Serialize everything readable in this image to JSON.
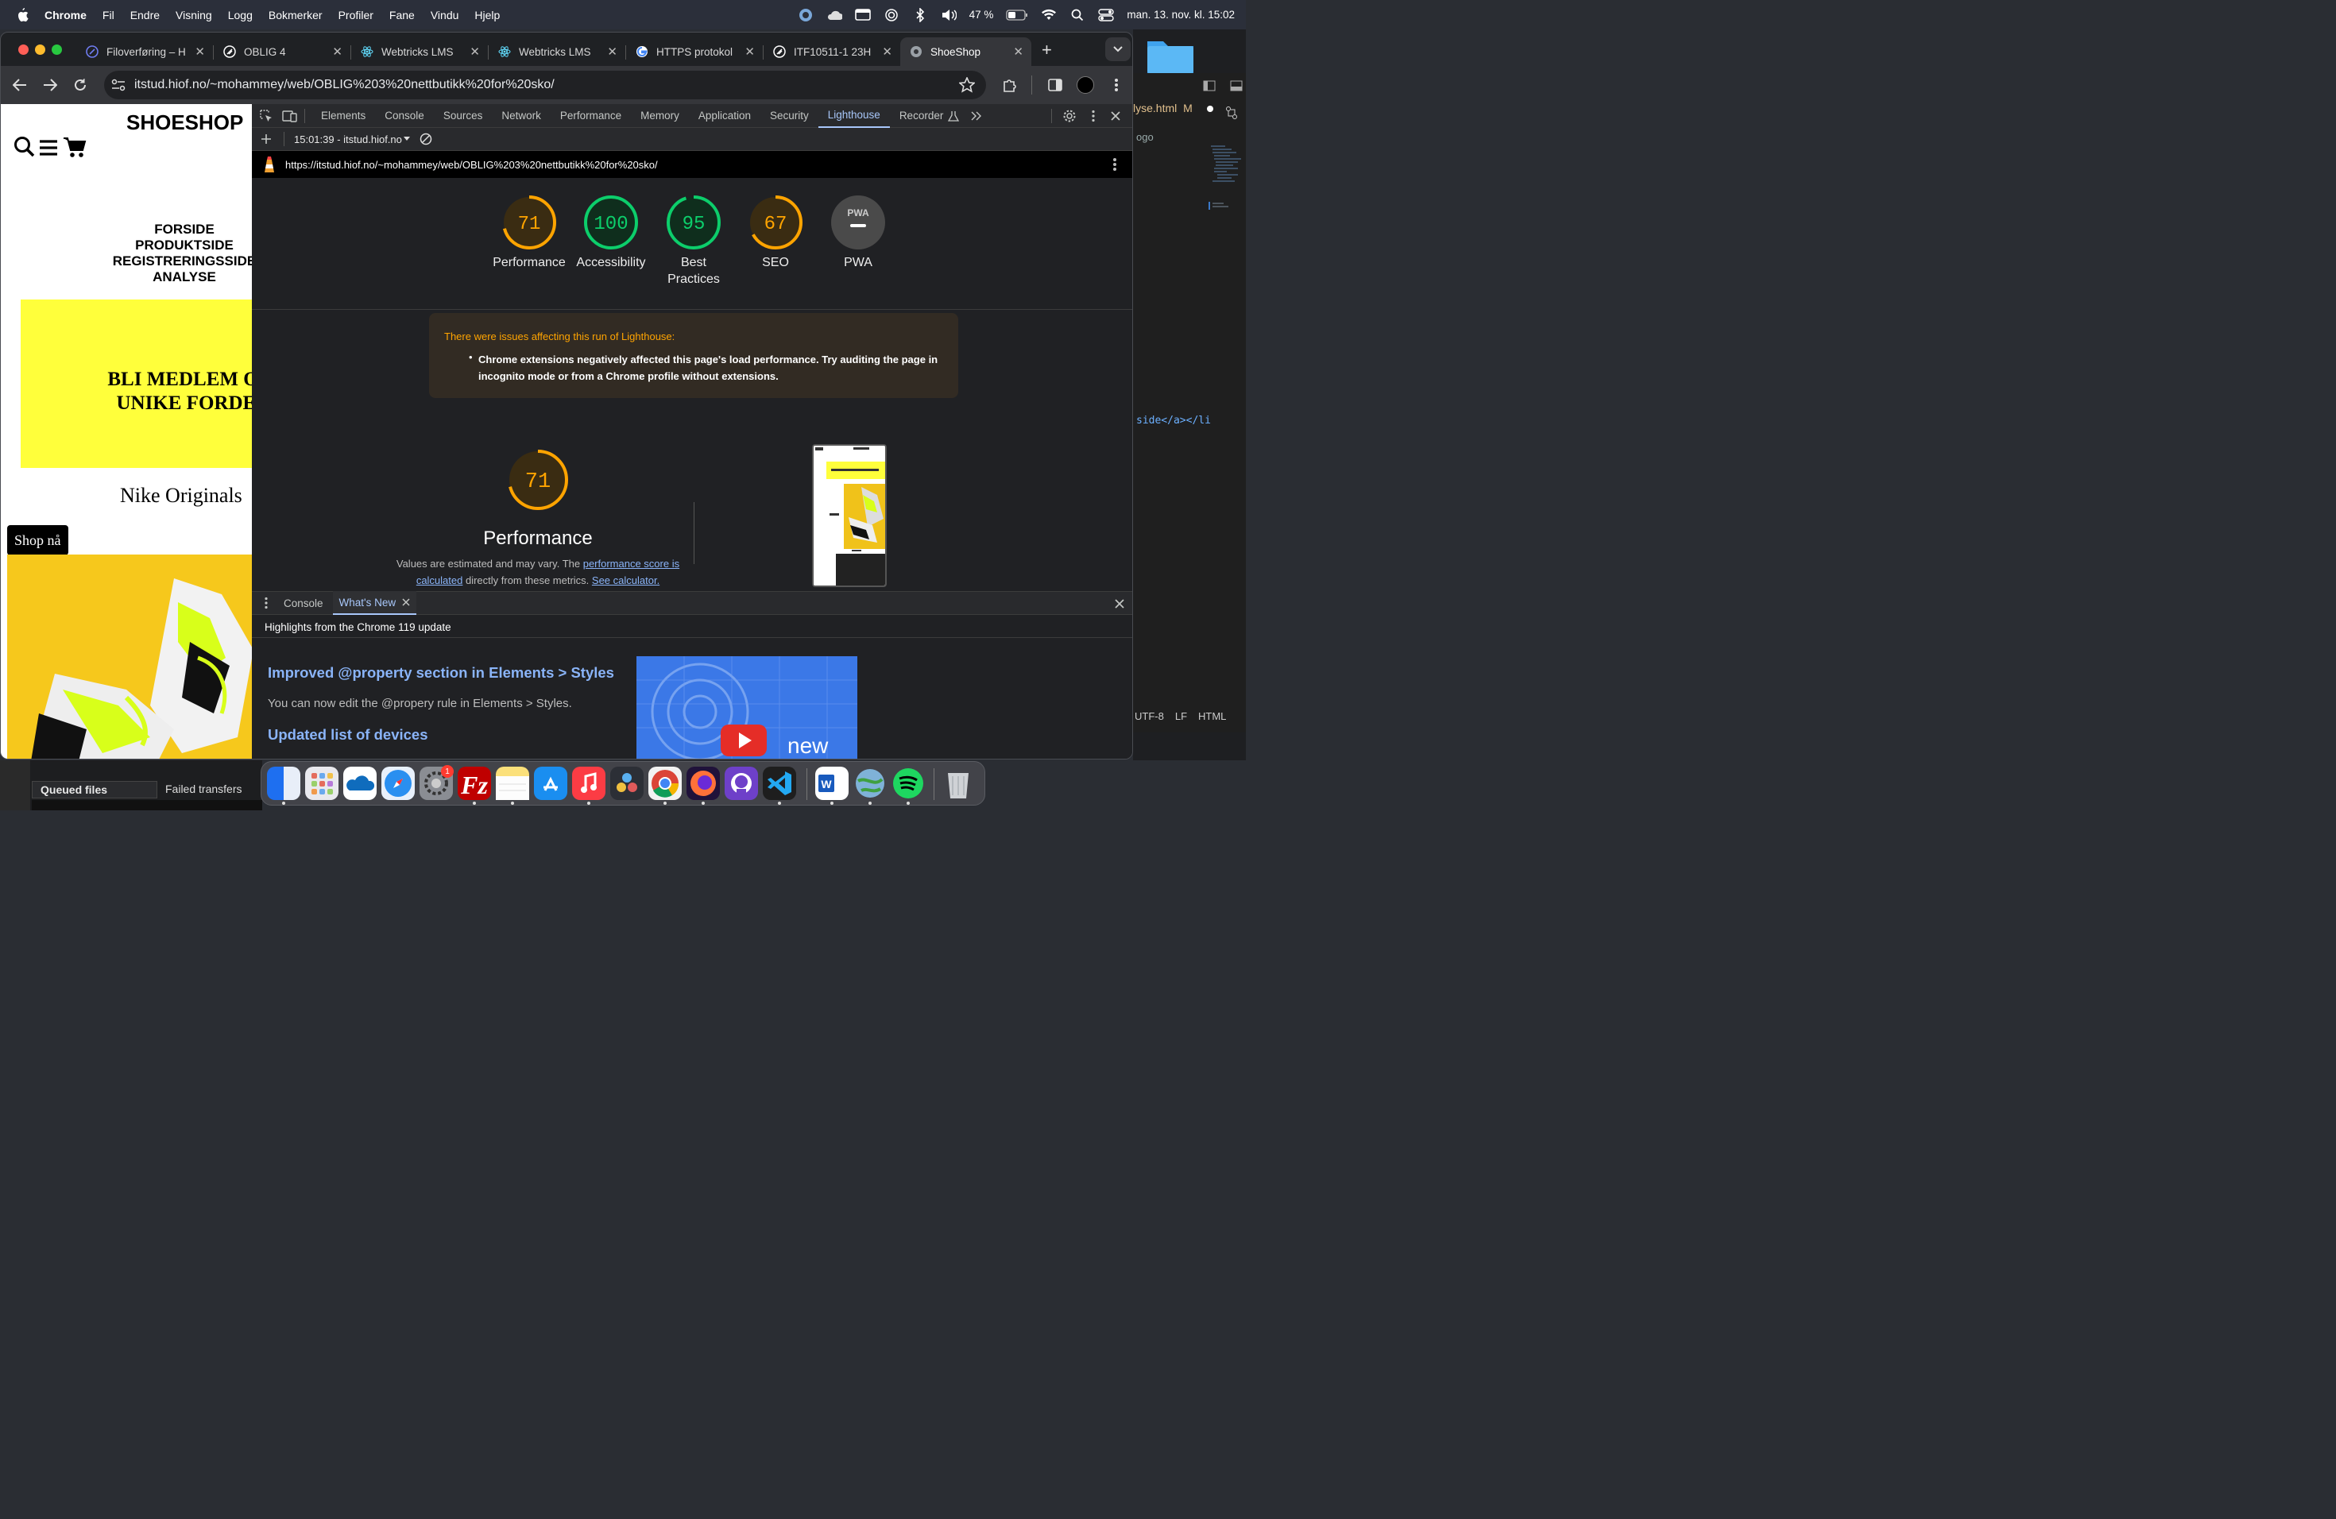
{
  "menubar": {
    "app": "Chrome",
    "items": [
      "Fil",
      "Endre",
      "Visning",
      "Logg",
      "Bokmerker",
      "Profiler",
      "Fane",
      "Vindu",
      "Hjelp"
    ],
    "battery": "47 %",
    "datetime": "man. 13. nov. kl. 15:02"
  },
  "tabs": [
    {
      "title": "Filoverføring – H",
      "icon": "filezilla-icon"
    },
    {
      "title": "OBLIG 4",
      "icon": "canvas-icon"
    },
    {
      "title": "Webtricks LMS",
      "icon": "react-icon"
    },
    {
      "title": "Webtricks LMS",
      "icon": "react-icon"
    },
    {
      "title": "HTTPS protokol",
      "icon": "google-icon"
    },
    {
      "title": "ITF10511-1 23H",
      "icon": "canvas-icon"
    },
    {
      "title": "ShoeShop",
      "icon": "globe-icon"
    }
  ],
  "omnibox": {
    "url": "itstud.hiof.no/~mohammey/web/OBLIG%203%20nettbutikk%20for%20sko/"
  },
  "page": {
    "logo": "SHOESHOP",
    "nav": [
      "FORSIDE",
      "PRODUKTSIDE",
      "REGISTRERINGSSIDE",
      "ANALYSE"
    ],
    "banner_line1": "BLI MEDLEM OG F",
    "banner_line2": "UNIKE FORDELE",
    "product_title": "Nike Originals",
    "shop_button": "Shop nå"
  },
  "devtools": {
    "tabs": [
      "Elements",
      "Console",
      "Sources",
      "Network",
      "Performance",
      "Memory",
      "Application",
      "Security",
      "Lighthouse",
      "Recorder"
    ],
    "active_tab": "Lighthouse",
    "report_selector": "15:01:39 - itstud.hiof.no",
    "report_url": "https://itstud.hiof.no/~mohammey/web/OBLIG%203%20nettbutikk%20for%20sko/",
    "pwa_badge": "PWA",
    "scores": [
      {
        "label": "Performance",
        "value": 71,
        "color": "#ffa400"
      },
      {
        "label": "Accessibility",
        "value": 100,
        "color": "#0cce6b"
      },
      {
        "label": "Best Practices",
        "value": 95,
        "color": "#0cce6b"
      },
      {
        "label": "SEO",
        "value": 67,
        "color": "#ffa400"
      },
      {
        "label": "PWA",
        "value": null,
        "color": "#9e9e9e"
      }
    ],
    "warning_title": "There were issues affecting this run of Lighthouse:",
    "warning_body": "Chrome extensions negatively affected this page's load performance. Try auditing the page in incognito mode or from a Chrome profile without extensions.",
    "perf_score": 71,
    "perf_title": "Performance",
    "perf_desc_1": "Values are estimated and may vary. The ",
    "perf_link_1": "performance score is calculated",
    "perf_desc_2": " directly from these metrics. ",
    "perf_link_2": "See calculator."
  },
  "drawer": {
    "tabs": [
      "Console",
      "What's New"
    ],
    "active": "What's New",
    "highlight": "Highlights from the Chrome 119 update",
    "h1": "Improved @property section in Elements > Styles",
    "p1": "You can now edit the @propery rule in Elements > Styles.",
    "h2": "Updated list of devices",
    "video_text": "new"
  },
  "vscode": {
    "tab": "lyse.html",
    "tab_status": "M",
    "line1": "ogo",
    "code": "side</a></li",
    "status": [
      "UTF-8",
      "LF",
      "HTML"
    ]
  },
  "filezilla": {
    "tab1": "Queued files",
    "tab2": "Failed transfers"
  },
  "dock": {
    "badge": "1"
  }
}
